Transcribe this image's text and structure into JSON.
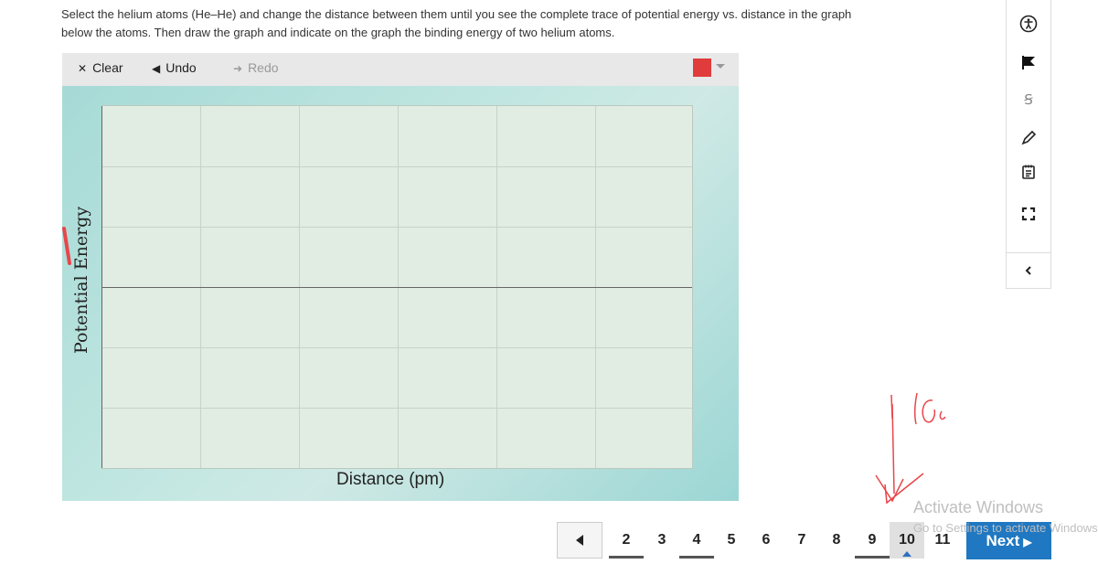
{
  "instructions": {
    "line1": "Select the helium atoms (He–He) and change the distance between them until you see the complete trace of potential energy vs. distance in the graph",
    "line2": "below the atoms. Then draw the graph and indicate on the graph the binding energy of two helium atoms."
  },
  "toolbar": {
    "clear_label": "Clear",
    "undo_label": "Undo",
    "redo_label": "Redo",
    "pen_color": "#e03c3c"
  },
  "graph": {
    "x_label": "Distance (pm)",
    "y_label": "Potential Energy"
  },
  "pager": {
    "pages": [
      "2",
      "3",
      "4",
      "5",
      "6",
      "7",
      "8",
      "9",
      "10",
      "11"
    ],
    "current": "10",
    "next_label": "Next"
  },
  "watermark": {
    "line1": "Activate Windows",
    "line2": "Go to Settings to activate Windows."
  },
  "rail_icons": [
    "accessibility-icon",
    "flag-icon",
    "strikethrough-icon",
    "pencil-icon",
    "notepad-icon",
    "fullscreen-icon",
    "collapse-icon"
  ],
  "colors": {
    "accent": "#1f78c1",
    "ink": "#e8464b"
  }
}
